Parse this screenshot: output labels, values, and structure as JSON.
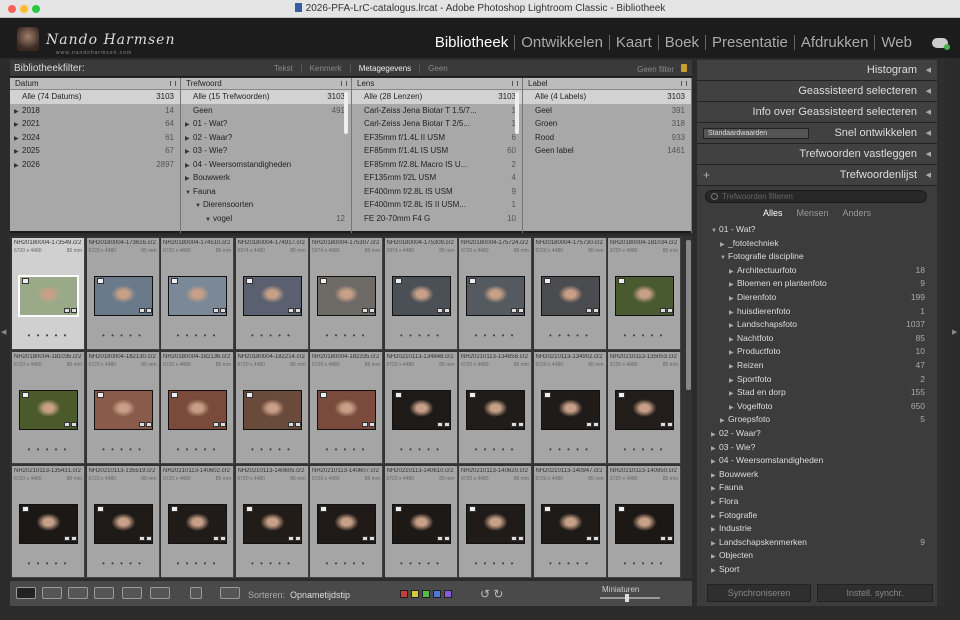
{
  "window": {
    "title": "2026-PFA-LrC-catalogus.lrcat - Adobe Photoshop Lightroom Classic - Bibliotheek"
  },
  "identity": {
    "signature": "Nando Harmsen",
    "subtitle": "www.nandoharmsen.com"
  },
  "modules": [
    "Bibliotheek",
    "Ontwikkelen",
    "Kaart",
    "Boek",
    "Presentatie",
    "Afdrukken",
    "Web"
  ],
  "active_module": "Bibliotheek",
  "filter": {
    "label": "Bibliotheekfilter:",
    "tabs": [
      "Tekst",
      "Kenmerk",
      "Metagegevens",
      "Geen"
    ],
    "active": "Metagegevens",
    "preset": "Geen filter"
  },
  "metadata_columns": [
    {
      "header": "Datum",
      "rows": [
        {
          "n": "Alle (74 Datums)",
          "c": "3103",
          "sel": true,
          "t": ""
        },
        {
          "n": "2018",
          "c": "14",
          "t": "▶"
        },
        {
          "n": "2021",
          "c": "64",
          "t": "▶"
        },
        {
          "n": "2024",
          "c": "61",
          "t": "▶"
        },
        {
          "n": "2025",
          "c": "67",
          "t": "▶"
        },
        {
          "n": "2026",
          "c": "2897",
          "t": "▶"
        }
      ]
    },
    {
      "header": "Trefwoord",
      "rows": [
        {
          "n": "Alle (15 Trefwoorden)",
          "c": "3103",
          "sel": true,
          "t": ""
        },
        {
          "n": "Geen",
          "c": "491",
          "t": ""
        },
        {
          "n": "01 - Wat?",
          "c": "",
          "t": "▶"
        },
        {
          "n": "02 - Waar?",
          "c": "",
          "t": "▶"
        },
        {
          "n": "03 - Wie?",
          "c": "",
          "t": "▶"
        },
        {
          "n": "04 - Weersomstandigheden",
          "c": "",
          "t": "▶"
        },
        {
          "n": "Bouwwerk",
          "c": "",
          "t": "▶"
        },
        {
          "n": "Fauna",
          "c": "",
          "t": "▼"
        },
        {
          "n": "Dierensoorten",
          "c": "",
          "t": "▼",
          "indent": 1
        },
        {
          "n": "vogel",
          "c": "12",
          "t": "▼",
          "indent": 2
        }
      ]
    },
    {
      "header": "Lens",
      "rows": [
        {
          "n": "Alle (28 Lenzen)",
          "c": "3103",
          "sel": true,
          "t": ""
        },
        {
          "n": "Carl-Zeiss Jena Biotar T 1.5/7...",
          "c": "1",
          "t": ""
        },
        {
          "n": "Carl-Zeiss Jena Biotar T 2/5...",
          "c": "1",
          "t": ""
        },
        {
          "n": "EF35mm f/1.4L II USM",
          "c": "6",
          "t": ""
        },
        {
          "n": "EF85mm f/1.4L IS USM",
          "c": "60",
          "t": ""
        },
        {
          "n": "EF85mm f/2.8L Macro IS U...",
          "c": "2",
          "t": ""
        },
        {
          "n": "EF135mm f/2L USM",
          "c": "4",
          "t": ""
        },
        {
          "n": "EF400mm f/2.8L IS USM",
          "c": "9",
          "t": ""
        },
        {
          "n": "EF400mm f/2.8L IS II USM...",
          "c": "1",
          "t": ""
        },
        {
          "n": "FE 20-70mm F4 G",
          "c": "10",
          "t": ""
        }
      ]
    },
    {
      "header": "Label",
      "rows": [
        {
          "n": "Alle (4 Labels)",
          "c": "3103",
          "sel": true,
          "t": ""
        },
        {
          "n": "Geel",
          "c": "391",
          "t": ""
        },
        {
          "n": "Groen",
          "c": "318",
          "t": ""
        },
        {
          "n": "Rood",
          "c": "933",
          "t": ""
        },
        {
          "n": "Geen label",
          "c": "1461",
          "t": ""
        }
      ]
    }
  ],
  "grid": [
    {
      "n": "NH20180004-173549.cr2",
      "d": "6720 x 4480",
      "mm": "85 mm",
      "bg": "#9aaa88",
      "sel": true
    },
    {
      "n": "NH20180004-173616.cr2",
      "d": "6720 x 4480",
      "mm": "85 mm",
      "bg": "#6a7a8a"
    },
    {
      "n": "NH20180004-174510.cr2",
      "d": "6720 x 4480",
      "mm": "85 mm",
      "bg": "#7a8898"
    },
    {
      "n": "NH20180004-174917.cr2",
      "d": "5974 x 4480",
      "mm": "85 mm",
      "bg": "#5a6070"
    },
    {
      "n": "NH20180004-175307.cr2",
      "d": "5974 x 4480",
      "mm": "85 mm",
      "bg": "#6e6a66"
    },
    {
      "n": "NH20180004-175309.cr2",
      "d": "5974 x 4480",
      "mm": "85 mm",
      "bg": "#4a5056"
    },
    {
      "n": "NH20180004-175724.cr2",
      "d": "6720 x 4480",
      "mm": "85 mm",
      "bg": "#555a60"
    },
    {
      "n": "NH20180004-175730.cr2",
      "d": "6720 x 4480",
      "mm": "85 mm",
      "bg": "#4a4c50"
    },
    {
      "n": "NH20180004-181034.cr2",
      "d": "6720 x 4480",
      "mm": "85 mm",
      "bg": "#4a5a30"
    },
    {
      "n": "NH20180004-181035.cr2",
      "d": "6720 x 4480",
      "mm": "85 mm",
      "bg": "#4a5a2a"
    },
    {
      "n": "NH20180004-182130.cr2",
      "d": "6720 x 4480",
      "mm": "85 mm",
      "bg": "#8a5a4a"
    },
    {
      "n": "NH20180004-182136.cr2",
      "d": "6720 x 4480",
      "mm": "85 mm",
      "bg": "#7a4a3a"
    },
    {
      "n": "NH20180004-182214.cr2",
      "d": "6720 x 4480",
      "mm": "85 mm",
      "bg": "#6a4a3a"
    },
    {
      "n": "NH20180004-182335.cr2",
      "d": "6720 x 4480",
      "mm": "85 mm",
      "bg": "#7a4a3c"
    },
    {
      "n": "NH20210113-134848.cr2",
      "d": "6720 x 4480",
      "mm": "85 mm",
      "bg": "#1e1a18"
    },
    {
      "n": "NH20210113-134858.cr2",
      "d": "6720 x 4480",
      "mm": "85 mm",
      "bg": "#201c1a"
    },
    {
      "n": "NH20210113-134902.cr2",
      "d": "6720 x 4480",
      "mm": "85 mm",
      "bg": "#1e1b19"
    },
    {
      "n": "NH20210113-135053.cr2",
      "d": "6720 x 4480",
      "mm": "85 mm",
      "bg": "#221d1a"
    },
    {
      "n": "NH20210113-135431.cr2",
      "d": "6720 x 4480",
      "mm": "85 mm",
      "bg": "#1c1816"
    },
    {
      "n": "NH20210113-135519.cr2",
      "d": "6720 x 4480",
      "mm": "85 mm",
      "bg": "#1e1a17"
    },
    {
      "n": "NH20210113-140602.cr2",
      "d": "6720 x 4480",
      "mm": "85 mm",
      "bg": "#201b18"
    },
    {
      "n": "NH20210113-140605.cr2",
      "d": "6720 x 4480",
      "mm": "85 mm",
      "bg": "#221c19"
    },
    {
      "n": "NH20210113-140607.cr2",
      "d": "6720 x 4480",
      "mm": "85 mm",
      "bg": "#1f1a17"
    },
    {
      "n": "NH20210113-140610.cr2",
      "d": "6720 x 4480",
      "mm": "85 mm",
      "bg": "#1d1916"
    },
    {
      "n": "NH20210113-140620.cr2",
      "d": "6720 x 4480",
      "mm": "85 mm",
      "bg": "#201b18"
    },
    {
      "n": "NH20210113-140947.cr2",
      "d": "6720 x 4480",
      "mm": "85 mm",
      "bg": "#1e1a17"
    },
    {
      "n": "NH20210113-140950.cr2",
      "d": "6720 x 4480",
      "mm": "85 mm",
      "bg": "#1c1815"
    }
  ],
  "toolbar": {
    "sort_label": "Sorteren:",
    "sort_value": "Opnametijdstip",
    "thumbs_label": "Miniaturen",
    "labels": [
      "#c83c3c",
      "#d8c83c",
      "#5cb84c",
      "#4a7ad8",
      "#8a5ad8"
    ]
  },
  "right_panels": {
    "histogram": "Histogram",
    "assisted": "Geassisteerd selecteren",
    "assisted_info": "Info over Geassisteerd selecteren",
    "quick_preset": "Standaardwaarden",
    "quick": "Snel ontwikkelen",
    "kw_set": "Trefwoorden vastleggen",
    "kw_list": "Trefwoordenlijst",
    "search_placeholder": "Trefwoorden filteren",
    "kw_tabs": [
      "Alles",
      "Mensen",
      "Anders"
    ],
    "sync": "Synchroniseren",
    "sync_settings": "Instell. synchr."
  },
  "keywords": [
    {
      "n": "01 - Wat?",
      "c": "",
      "t": "▼",
      "i": 0
    },
    {
      "n": "_fototechniek",
      "c": "",
      "t": "▶",
      "i": 1
    },
    {
      "n": "Fotografie discipline",
      "c": "",
      "t": "▼",
      "i": 1
    },
    {
      "n": "Architectuurfoto",
      "c": "18",
      "t": "▶",
      "i": 2
    },
    {
      "n": "Bloemen en plantenfoto",
      "c": "9",
      "t": "▶",
      "i": 2
    },
    {
      "n": "Dierenfoto",
      "c": "199",
      "t": "▶",
      "i": 2
    },
    {
      "n": "huisdierenfoto",
      "c": "1",
      "t": "▶",
      "i": 2
    },
    {
      "n": "Landschapsfoto",
      "c": "1037",
      "t": "▶",
      "i": 2
    },
    {
      "n": "Nachtfoto",
      "c": "85",
      "t": "▶",
      "i": 2
    },
    {
      "n": "Productfoto",
      "c": "10",
      "t": "▶",
      "i": 2
    },
    {
      "n": "Reizen",
      "c": "47",
      "t": "▶",
      "i": 2
    },
    {
      "n": "Sportfoto",
      "c": "2",
      "t": "▶",
      "i": 2
    },
    {
      "n": "Stad en dorp",
      "c": "155",
      "t": "▶",
      "i": 2
    },
    {
      "n": "Vogelfoto",
      "c": "650",
      "t": "▶",
      "i": 2
    },
    {
      "n": "Groepsfoto",
      "c": "5",
      "t": "▶",
      "i": 1
    },
    {
      "n": "02 - Waar?",
      "c": "",
      "t": "▶",
      "i": 0
    },
    {
      "n": "03 - Wie?",
      "c": "",
      "t": "▶",
      "i": 0
    },
    {
      "n": "04 - Weersomstandigheden",
      "c": "",
      "t": "▶",
      "i": 0
    },
    {
      "n": "Bouwwerk",
      "c": "",
      "t": "▶",
      "i": 0
    },
    {
      "n": "Fauna",
      "c": "",
      "t": "▶",
      "i": 0
    },
    {
      "n": "Flora",
      "c": "",
      "t": "▶",
      "i": 0
    },
    {
      "n": "Fotografie",
      "c": "",
      "t": "▶",
      "i": 0
    },
    {
      "n": "Industrie",
      "c": "",
      "t": "▶",
      "i": 0
    },
    {
      "n": "Landschapskenmerken",
      "c": "9",
      "t": "▶",
      "i": 0
    },
    {
      "n": "Objecten",
      "c": "",
      "t": "▶",
      "i": 0
    },
    {
      "n": "Sport",
      "c": "",
      "t": "▶",
      "i": 0
    }
  ]
}
